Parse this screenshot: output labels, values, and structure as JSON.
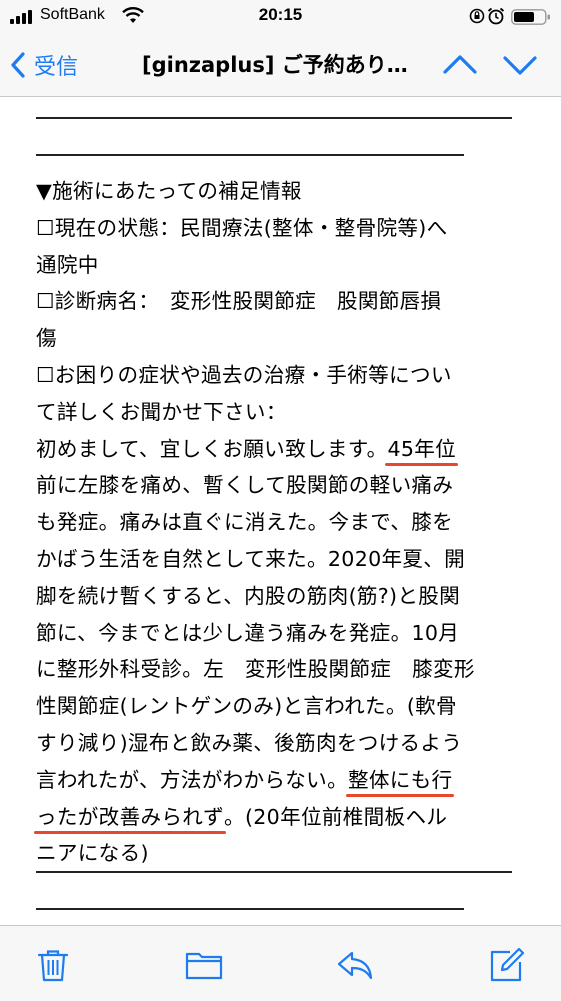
{
  "status_bar": {
    "carrier": "SoftBank",
    "time": "20:15"
  },
  "nav": {
    "back_label": "受信",
    "title": "[ginzaplus] ご予約あり…"
  },
  "email": {
    "lines": [
      "▼施術にあたっての補足情報",
      "☐現在の状態：民間療法(整体・整骨院等)へ",
      "通院中",
      "☐診断病名：　変形性股関節症　股関節唇損",
      "傷",
      "☐お困りの症状や過去の治療・手術等につい",
      "て詳しくお聞かせ下さい：",
      "初めまして、宜しくお願い致します。",
      "45年位",
      "前に左膝を痛め、暫くして股関節の軽い痛み",
      "も発症。痛みは直ぐに消えた。今まで、膝を",
      "かばう生活を自然として来た。2020年夏、開",
      "脚を続け暫くすると、内股の筋肉(筋?)と股関",
      "節に、今までとは少し違う痛みを発症。10月",
      "に整形外科受診。左　変形性股関節症　膝変形",
      "性関節症(レントゲンのみ)と言われた。(軟骨",
      "すり減り)湿布と飲み薬、後筋肉をつけるよう",
      "言われたが、方法がわからない。",
      "整体にも行",
      "ったが改善みられず",
      "。(20年位前椎間板ヘル",
      "ニアになる)"
    ]
  },
  "colors": {
    "accent": "#1e7cf0",
    "highlight_underline": "#e5482d"
  },
  "icons": [
    "signal-icon",
    "wifi-icon",
    "orientation-lock-icon",
    "alarm-icon",
    "battery-icon",
    "back-chevron-icon",
    "chevron-up-icon",
    "chevron-down-icon",
    "trash-icon",
    "folder-icon",
    "reply-icon",
    "compose-icon"
  ]
}
